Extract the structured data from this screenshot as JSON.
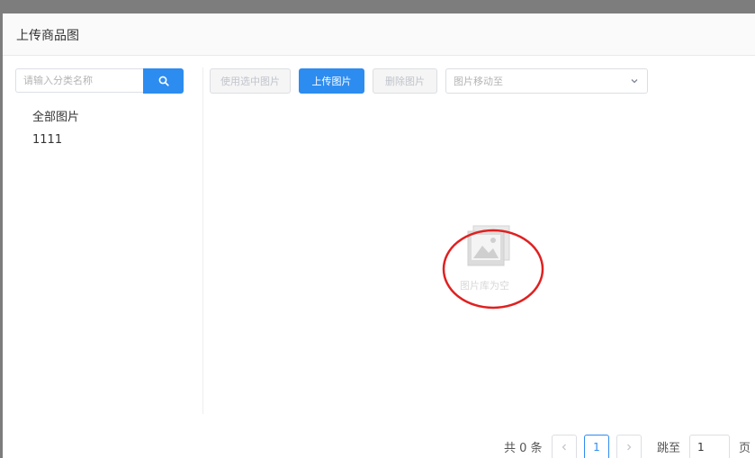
{
  "dialog": {
    "title": "上传商品图"
  },
  "sidebar": {
    "search": {
      "placeholder": "请输入分类名称",
      "icon": "search-icon"
    },
    "categories": [
      {
        "label": "全部图片"
      },
      {
        "label": "1111"
      }
    ]
  },
  "toolbar": {
    "use_selected_label": "使用选中图片",
    "upload_label": "上传图片",
    "delete_label": "删除图片",
    "move_to_placeholder": "图片移动至"
  },
  "gallery": {
    "empty_text": "图片库为空",
    "empty_icon": "image-icon"
  },
  "pagination": {
    "total_text": "共 0 条",
    "current_page": "1",
    "jump_label": "跳至",
    "jump_value": "1",
    "page_suffix": "页"
  },
  "colors": {
    "primary": "#2d8cf0",
    "annotation": "#e02020"
  }
}
